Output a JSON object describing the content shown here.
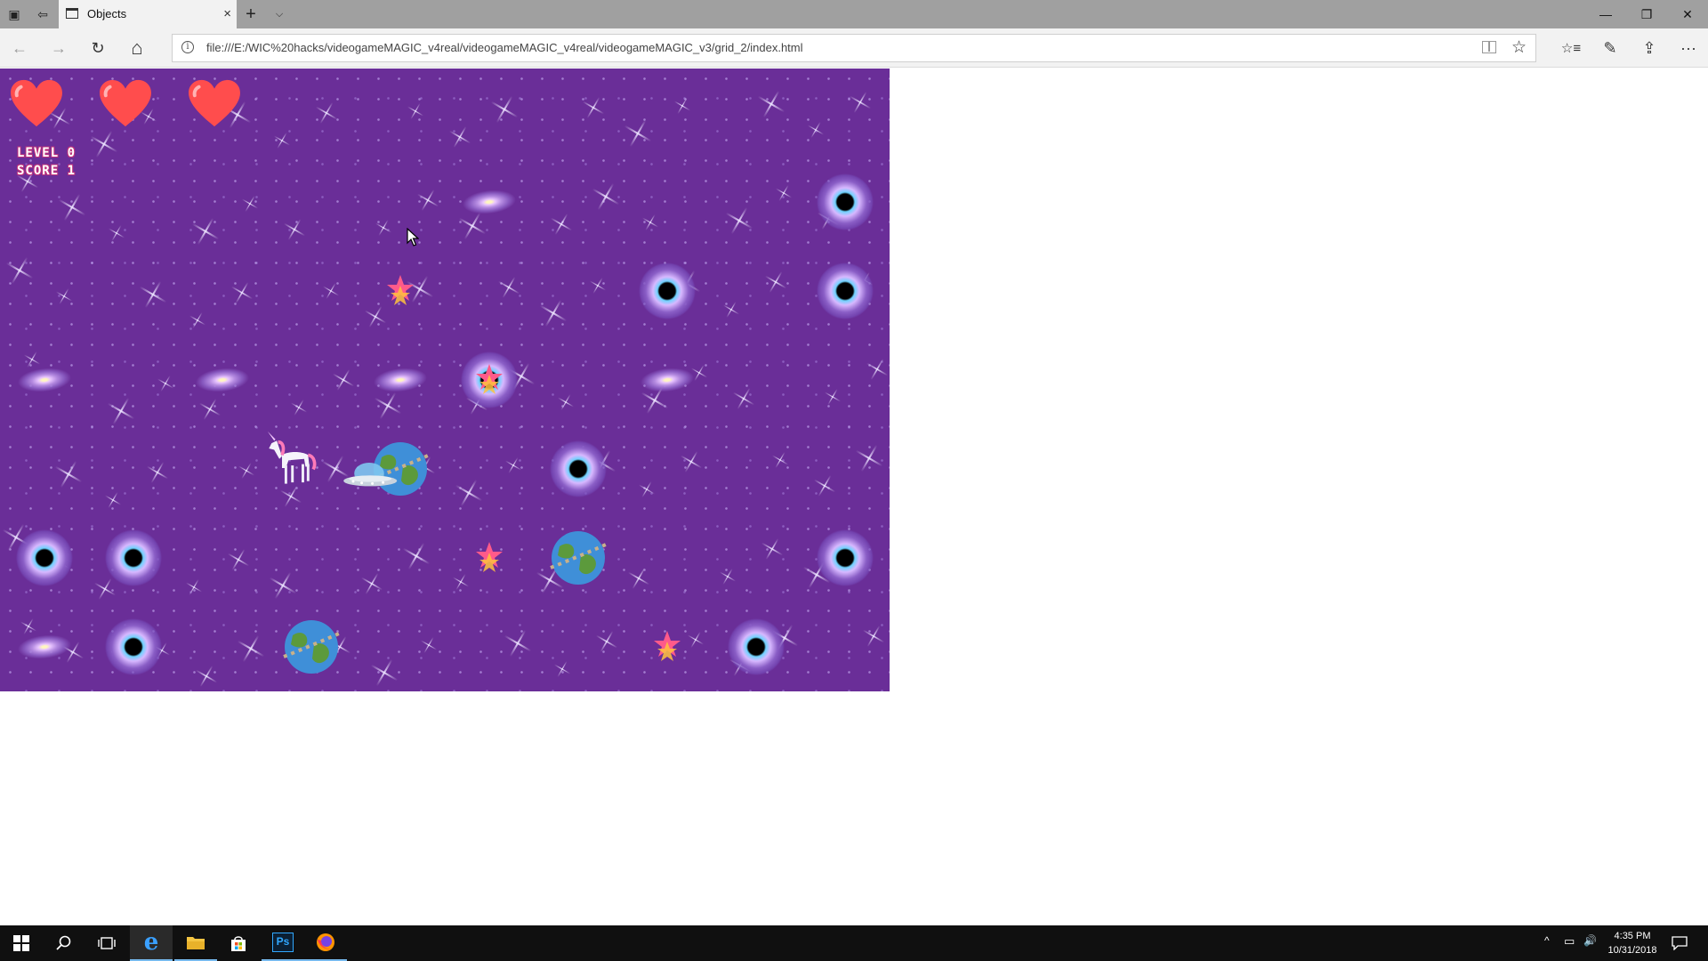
{
  "browser": {
    "tab_title": "Objects",
    "url": "file:///E:/WIC%20hacks/videogameMAGIC_v4real/videogameMAGIC_v4real/videogameMAGIC_v3/grid_2/index.html",
    "new_tab_symbol": "+",
    "tab_close_symbol": "×"
  },
  "game": {
    "level_label": "LEVEL 0",
    "score_label": "SCORE 1",
    "lives": 3,
    "colors": {
      "background": "#6a2e98",
      "heart": "#ff4d4d"
    },
    "objects": [
      {
        "type": "galaxy",
        "col": 5,
        "row": 1
      },
      {
        "type": "blackhole",
        "col": 9,
        "row": 1
      },
      {
        "type": "star-pickup",
        "col": 4,
        "row": 2
      },
      {
        "type": "blackhole",
        "col": 7,
        "row": 2
      },
      {
        "type": "blackhole",
        "col": 9,
        "row": 2
      },
      {
        "type": "galaxy",
        "col": 0,
        "row": 3
      },
      {
        "type": "galaxy",
        "col": 2,
        "row": 3
      },
      {
        "type": "galaxy",
        "col": 4,
        "row": 3
      },
      {
        "type": "blackhole",
        "col": 5,
        "row": 3
      },
      {
        "type": "star-pickup",
        "col": 5,
        "row": 3
      },
      {
        "type": "galaxy",
        "col": 7,
        "row": 3
      },
      {
        "type": "unicorn",
        "col": 3,
        "row": 4
      },
      {
        "type": "planet",
        "col": 4,
        "row": 4
      },
      {
        "type": "ufo",
        "col": 4,
        "row": 4
      },
      {
        "type": "blackhole",
        "col": 6,
        "row": 4
      },
      {
        "type": "blackhole",
        "col": 0,
        "row": 5
      },
      {
        "type": "blackhole",
        "col": 1,
        "row": 5
      },
      {
        "type": "star-pickup",
        "col": 5,
        "row": 5
      },
      {
        "type": "planet",
        "col": 6,
        "row": 5
      },
      {
        "type": "blackhole",
        "col": 9,
        "row": 5
      },
      {
        "type": "galaxy",
        "col": 0,
        "row": 6
      },
      {
        "type": "blackhole",
        "col": 1,
        "row": 6
      },
      {
        "type": "planet",
        "col": 3,
        "row": 6
      },
      {
        "type": "star-pickup",
        "col": 7,
        "row": 6
      },
      {
        "type": "blackhole",
        "col": 8,
        "row": 6
      }
    ]
  },
  "taskbar": {
    "time": "4:35 PM",
    "date": "10/31/2018",
    "apps": [
      "start",
      "search",
      "task-view",
      "edge",
      "file-explorer",
      "store",
      "photoshop",
      "firefox"
    ],
    "photoshop_label": "Ps"
  },
  "icons": {
    "back": "←",
    "forward": "→",
    "refresh": "↻",
    "home": "⌂",
    "favorite": "☆",
    "favorites_hub": "☆≡",
    "notes": "✎",
    "share": "⇪",
    "more": "···",
    "minimize": "—",
    "restore": "❐",
    "close": "✕",
    "tray_chevron": "^",
    "network": "▭",
    "volume": "🔊"
  }
}
